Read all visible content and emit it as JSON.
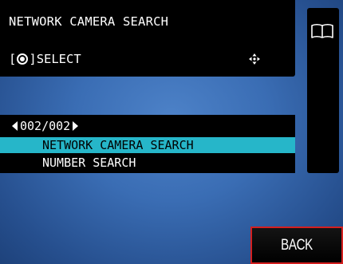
{
  "header": {
    "title": "NETWORK CAMERA SEARCH",
    "select_hint": "SELECT",
    "select_button_icon": "ring-button-icon",
    "nav_icon": "dpad-arrows-icon"
  },
  "side_panel": {
    "icon": "book-icon"
  },
  "list": {
    "page_indicator": "002/002",
    "items": [
      {
        "label": "NETWORK CAMERA SEARCH",
        "selected": true
      },
      {
        "label": "NUMBER SEARCH",
        "selected": false
      }
    ]
  },
  "back_button": {
    "label": "BACK"
  },
  "colors": {
    "background": "#3a6db4",
    "panel": "#000000",
    "selection": "#26b6c9",
    "focus_border": "#d41f1f",
    "text": "#ffffff"
  }
}
